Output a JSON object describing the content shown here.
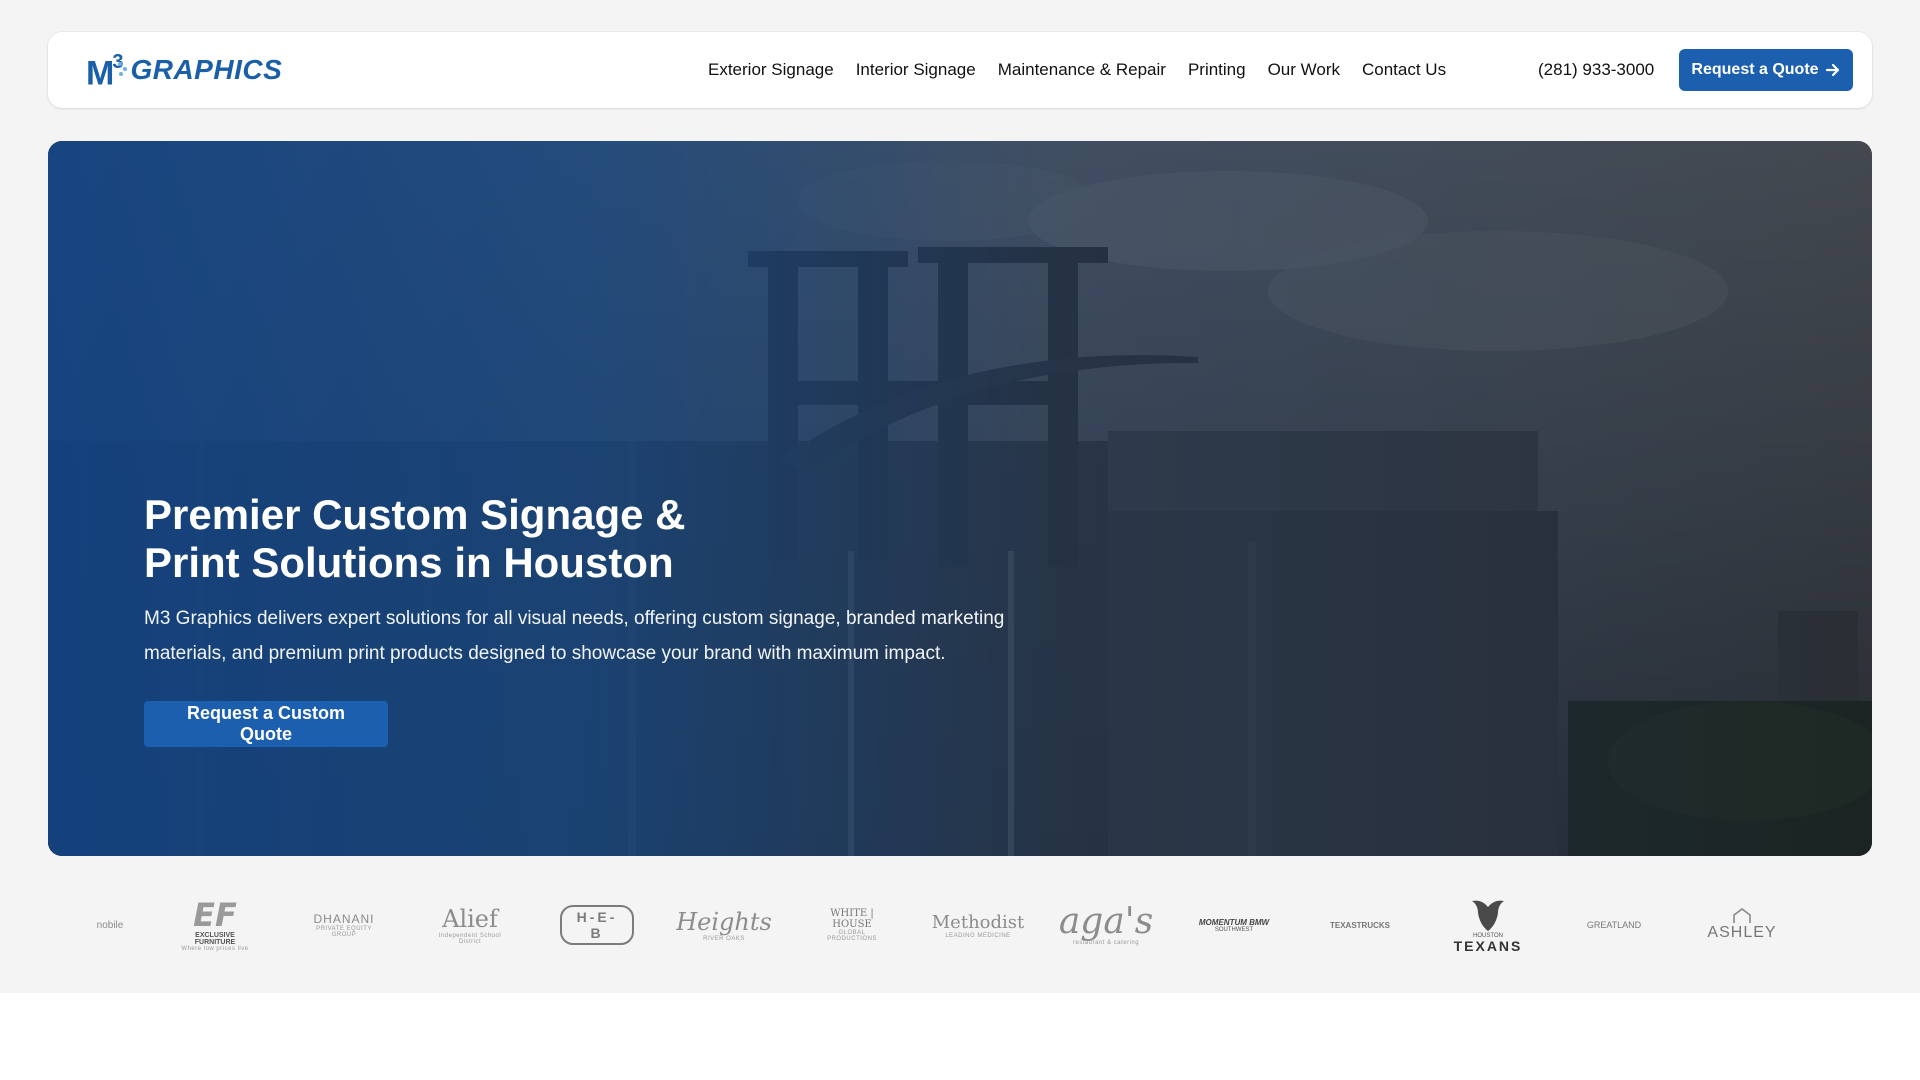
{
  "header": {
    "logo": {
      "mark": "M",
      "superscript": "3",
      "text": "GRAPHICS"
    },
    "nav": [
      {
        "label": "Exterior Signage"
      },
      {
        "label": "Interior Signage"
      },
      {
        "label": "Maintenance & Repair"
      },
      {
        "label": "Printing"
      },
      {
        "label": "Our Work"
      },
      {
        "label": "Contact Us"
      }
    ],
    "phone": "(281) 933-3000",
    "cta_label": "Request a Quote",
    "cta_icon": "arrow-right-icon"
  },
  "hero": {
    "title": "Premier Custom Signage & Print Solutions in Houston",
    "description": "M3 Graphics delivers expert solutions for all visual needs, offering custom signage, branded marketing materials, and premium print products designed to showcase your brand with maximum impact.",
    "cta_label": "Request a Custom Quote"
  },
  "clients": [
    {
      "name": "nobile",
      "line1": "nobile",
      "line2": ""
    },
    {
      "name": "EF",
      "line1": "EF",
      "line2": "EXCLUSIVE FURNITURE",
      "line3": "Where low prices live"
    },
    {
      "name": "Dhanani",
      "line1": "DHANANI",
      "line2": "PRIVATE EQUITY GROUP"
    },
    {
      "name": "Alief",
      "line1": "Alief",
      "line2": "Independent School District"
    },
    {
      "name": "HEB",
      "line1": "H-E-B"
    },
    {
      "name": "Heights",
      "line1": "Heights",
      "line2": "RIVER OAKS"
    },
    {
      "name": "White House",
      "line1": "WHITE | HOUSE",
      "line2": "GLOBAL PRODUCTIONS"
    },
    {
      "name": "Methodist",
      "line1": "Methodist",
      "line2": "LEADING MEDICINE"
    },
    {
      "name": "Aga's",
      "line1": "aga's",
      "line2": "restaurant & catering"
    },
    {
      "name": "Momentum BMW",
      "line1": "MOMENTUM BMW",
      "line2": "SOUTHWEST"
    },
    {
      "name": "Texas Trucks",
      "line1": "TEXASTRUCKS"
    },
    {
      "name": "Houston Texans",
      "line1": "HOUSTON",
      "line2": "TEXANS"
    },
    {
      "name": "Greatland",
      "line1": "GREATLAND"
    },
    {
      "name": "Ashley",
      "line1": "ASHLEY"
    }
  ],
  "colors": {
    "brand_blue": "#1b5fae",
    "logo_blue": "#1a5fa8",
    "page_bg": "#f4f4f5"
  }
}
